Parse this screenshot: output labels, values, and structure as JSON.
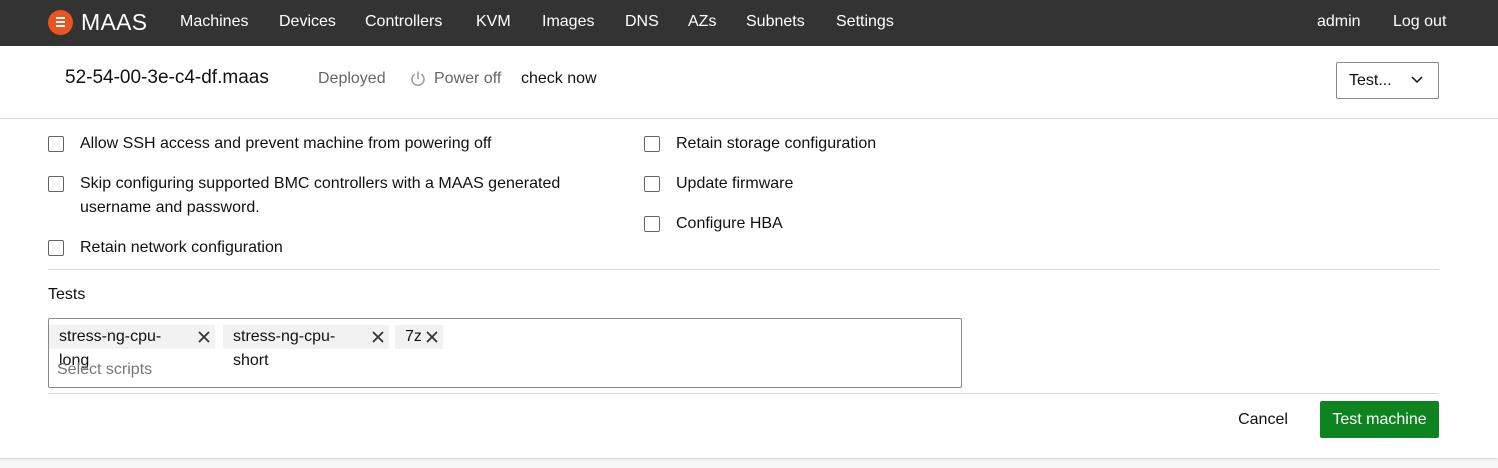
{
  "app": {
    "name": "MAAS"
  },
  "nav": {
    "items": [
      {
        "label": "Machines"
      },
      {
        "label": "Devices"
      },
      {
        "label": "Controllers"
      },
      {
        "label": "KVM"
      },
      {
        "label": "Images"
      },
      {
        "label": "DNS"
      },
      {
        "label": "AZs"
      },
      {
        "label": "Subnets"
      },
      {
        "label": "Settings"
      }
    ],
    "user": "admin",
    "logout": "Log out"
  },
  "machine": {
    "hostname": "52-54-00-3e-c4-df.maas",
    "status": "Deployed",
    "power_state": "Power off",
    "check_power": "check now",
    "action_selected": "Test..."
  },
  "options": {
    "allow_ssh": {
      "label": "Allow SSH access and prevent machine from powering off",
      "checked": false
    },
    "skip_bmc": {
      "label": "Skip configuring supported BMC controllers with a MAAS generated username and password.",
      "checked": false
    },
    "retain_network": {
      "label": "Retain network configuration",
      "checked": false
    },
    "retain_storage": {
      "label": "Retain storage configuration",
      "checked": false
    },
    "update_firmware": {
      "label": "Update firmware",
      "checked": false
    },
    "configure_hba": {
      "label": "Configure HBA",
      "checked": false
    }
  },
  "tests": {
    "label": "Tests",
    "selected": [
      {
        "name": "stress-ng-cpu-long"
      },
      {
        "name": "stress-ng-cpu-short"
      },
      {
        "name": "7z"
      }
    ],
    "placeholder": "Select scripts"
  },
  "footer": {
    "cancel": "Cancel",
    "submit": "Test machine"
  },
  "colors": {
    "topbar": "#333333",
    "brand": "#e95420",
    "positive": "#0e8420"
  }
}
